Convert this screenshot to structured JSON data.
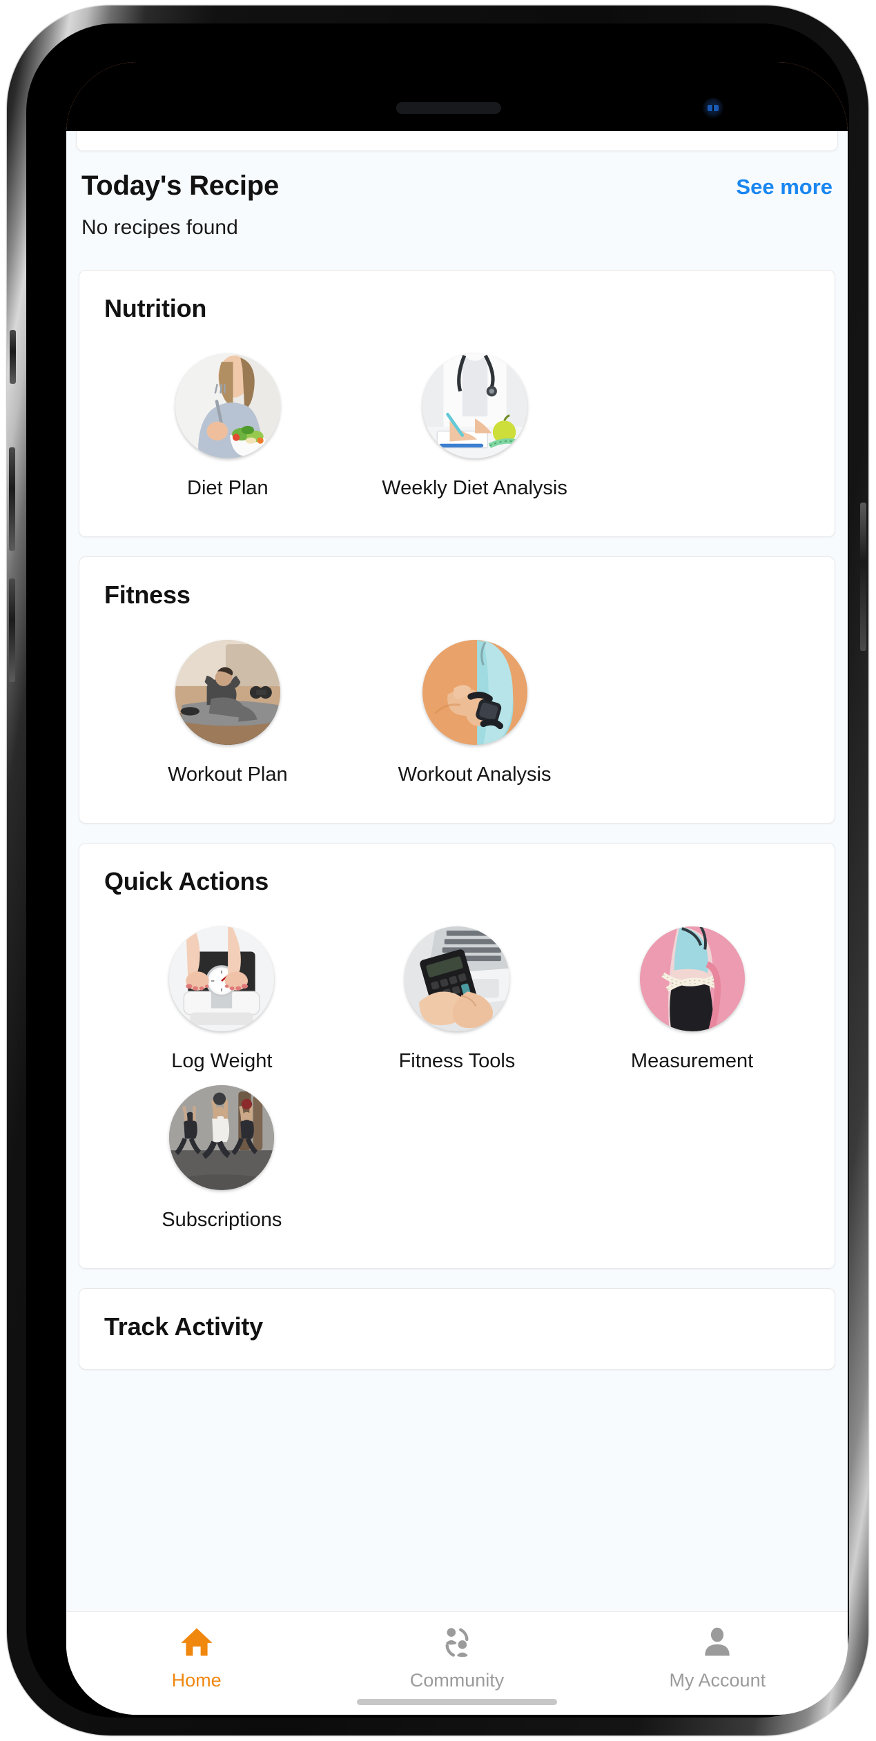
{
  "theme": {
    "brand_orange": "#ef5c0a",
    "link_blue": "#1a86f0",
    "active_tab": "#f0870e",
    "page_background": "#f7fbfe",
    "card_background": "#ffffff"
  },
  "recipe": {
    "title": "Today's Recipe",
    "see_more_label": "See more",
    "empty_text": "No recipes found"
  },
  "sections": [
    {
      "id": "nutrition",
      "title": "Nutrition",
      "tiles": [
        {
          "label": "Diet Plan",
          "icon": "woman-eating-salad-photo"
        },
        {
          "label": "Weekly Diet Analysis",
          "icon": "doctor-writing-notes-photo"
        }
      ]
    },
    {
      "id": "fitness",
      "title": "Fitness",
      "tiles": [
        {
          "label": "Workout Plan",
          "icon": "man-doing-situps-photo"
        },
        {
          "label": "Workout Analysis",
          "icon": "wrist-smartwatch-photo"
        }
      ]
    },
    {
      "id": "quick-actions",
      "title": "Quick Actions",
      "tiles": [
        {
          "label": "Log Weight",
          "icon": "feet-on-weighing-scale-photo"
        },
        {
          "label": "Fitness Tools",
          "icon": "calculator-laptop-photo"
        },
        {
          "label": "Measurement",
          "icon": "waist-tape-measure-photo"
        },
        {
          "label": "Subscriptions",
          "icon": "group-workout-class-photo"
        }
      ]
    },
    {
      "id": "track-activity",
      "title": "Track Activity",
      "tiles": []
    }
  ],
  "tabbar": {
    "items": [
      {
        "label": "Home",
        "icon": "home-icon",
        "active": true
      },
      {
        "label": "Community",
        "icon": "community-icon",
        "active": false
      },
      {
        "label": "My Account",
        "icon": "person-icon",
        "active": false
      }
    ]
  }
}
